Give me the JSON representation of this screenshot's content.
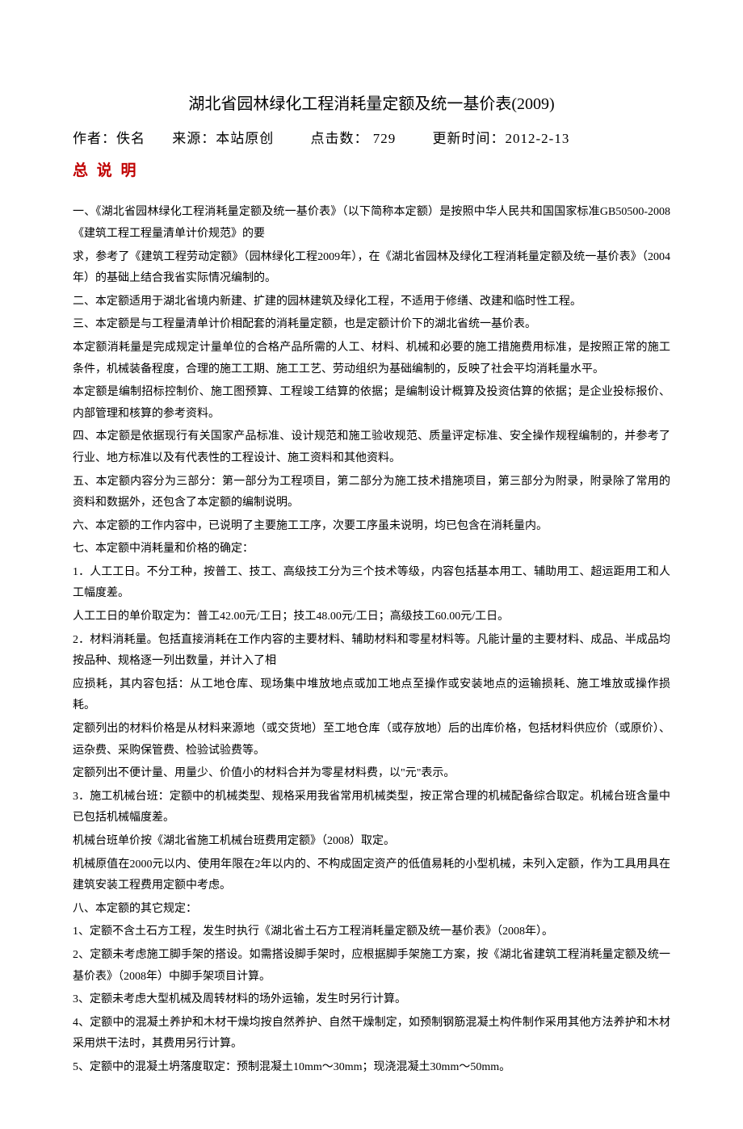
{
  "title": "湖北省园林绿化工程消耗量定额及统一基价表(2009)",
  "meta": {
    "author_label": "作者：",
    "author_value": "佚名",
    "source_label": "来源：",
    "source_value": "本站原创",
    "hits_label": "点击数：",
    "hits_value": "729",
    "update_label": "更新时间：",
    "update_value": "2012-2-13"
  },
  "section_header": "总 说 明",
  "paragraphs": {
    "p1": "一、《湖北省园林绿化工程消耗量定额及统一基价表》（以下简称本定额）是按照中华人民共和国国家标准GB50500-2008《建筑工程工程量清单计价规范》的要",
    "p2": "求，参考了《建筑工程劳动定额》（园林绿化工程2009年），在《湖北省园林及绿化工程消耗量定额及统一基价表》（2004年）的基础上结合我省实际情况编制的。",
    "p3": "二、本定额适用于湖北省境内新建、扩建的园林建筑及绿化工程，不适用于修缮、改建和临时性工程。",
    "p4": "三、本定额是与工程量清单计价相配套的消耗量定额，也是定额计价下的湖北省统一基价表。",
    "p5": "本定额消耗量是完成规定计量单位的合格产品所需的人工、材料、机械和必要的施工措施费用标准，是按照正常的施工条件，机械装备程度，合理的施工工期、施工工艺、劳动组织为基础编制的，反映了社会平均消耗量水平。",
    "p6": "本定额是编制招标控制价、施工图预算、工程竣工结算的依据；是编制设计概算及投资估算的依据；是企业投标报价、内部管理和核算的参考资料。",
    "p7": "四、本定额是依据现行有关国家产品标准、设计规范和施工验收规范、质量评定标准、安全操作规程编制的，并参考了行业、地方标准以及有代表性的工程设计、施工资料和其他资料。",
    "p8": "五、本定额内容分为三部分：第一部分为工程项目，第二部分为施工技术措施项目，第三部分为附录，附录除了常用的资料和数据外，还包含了本定额的编制说明。",
    "p9": "六、本定额的工作内容中，已说明了主要施工工序，次要工序虽未说明，均已包含在消耗量内。",
    "p10": "七、本定额中消耗量和价格的确定：",
    "p11": "1．人工工日。不分工种，按普工、技工、高级技工分为三个技术等级，内容包括基本用工、辅助用工、超运距用工和人工幅度差。",
    "p12": "人工工日的单价取定为：普工42.00元/工日；技工48.00元/工日；高级技工60.00元/工日。",
    "p13": "2．材料消耗量。包括直接消耗在工作内容的主要材料、辅助材料和零星材料等。凡能计量的主要材料、成品、半成品均按品种、规格逐一列出数量，并计入了相",
    "p14": "应损耗，其内容包括：从工地仓库、现场集中堆放地点或加工地点至操作或安装地点的运输损耗、施工堆放或操作损耗。",
    "p15": "定额列出的材料价格是从材料来源地（或交货地）至工地仓库（或存放地）后的出库价格，包括材料供应价（或原价）、运杂费、采购保管费、检验试验费等。",
    "p16": "定额列出不便计量、用量少、价值小的材料合并为零星材料费，以\"元\"表示。",
    "p17": "3．施工机械台班：定额中的机械类型、规格采用我省常用机械类型，按正常合理的机械配备综合取定。机械台班含量中已包括机械幅度差。",
    "p18": "机械台班单价按《湖北省施工机械台班费用定额》（2008）取定。",
    "p19": "机械原值在2000元以内、使用年限在2年以内的、不构成固定资产的低值易耗的小型机械，未列入定额，作为工具用具在建筑安装工程费用定额中考虑。",
    "p20": "八、本定额的其它规定：",
    "p21": "1、定额不含土石方工程，发生时执行《湖北省土石方工程消耗量定额及统一基价表》（2008年）。",
    "p22": "2、定额未考虑施工脚手架的搭设。如需搭设脚手架时，应根据脚手架施工方案，按《湖北省建筑工程消耗量定额及统一基价表》（2008年）中脚手架项目计算。",
    "p23": "3、定额未考虑大型机械及周转材料的场外运输，发生时另行计算。",
    "p24": "4、定额中的混凝土养护和木材干燥均按自然养护、自然干燥制定，如预制钢筋混凝土构件制作采用其他方法养护和木材采用烘干法时，其费用另行计算。",
    "p25": "5、定额中的混凝土坍落度取定：预制混凝土10mm～30mm；现浇混凝土30mm～50mm。"
  }
}
